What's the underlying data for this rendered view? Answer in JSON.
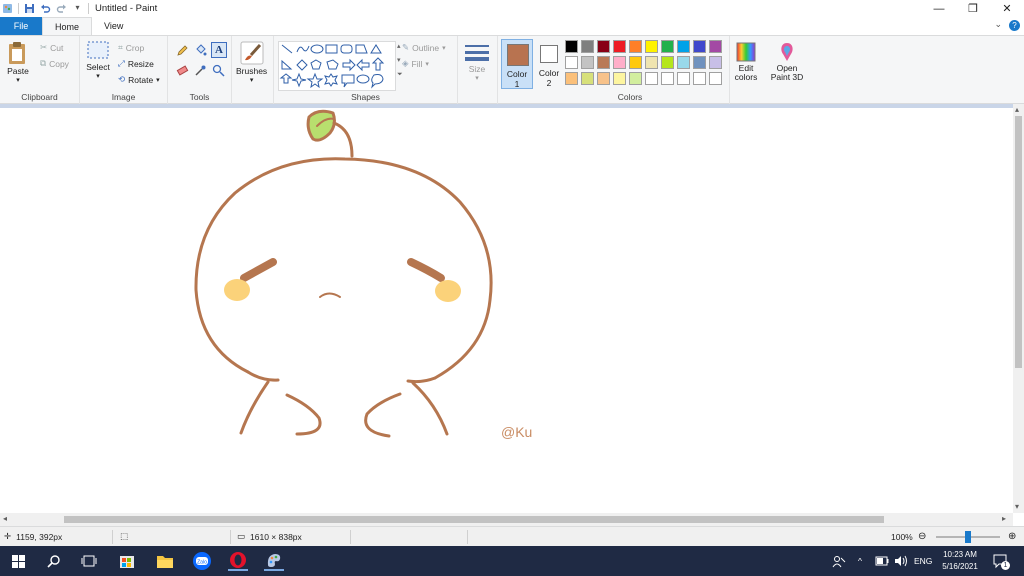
{
  "window": {
    "title": "Untitled - Paint",
    "minimize_glyph": "—",
    "restore_glyph": "❐",
    "close_glyph": "✕"
  },
  "tabs": [
    {
      "label": "File"
    },
    {
      "label": "Home"
    },
    {
      "label": "View"
    }
  ],
  "ribbon": {
    "clipboard": {
      "label": "Clipboard",
      "paste": "Paste",
      "cut": "Cut",
      "copy": "Copy"
    },
    "image": {
      "label": "Image",
      "select": "Select",
      "crop": "Crop",
      "resize": "Resize",
      "rotate": "Rotate"
    },
    "tools": {
      "label": "Tools"
    },
    "brushes": {
      "label": "Brushes"
    },
    "shapes": {
      "label": "Shapes",
      "outline": "Outline",
      "fill": "Fill"
    },
    "size": {
      "label": "Size"
    },
    "color1": {
      "label": "Color",
      "num": "1",
      "color": "#b87350"
    },
    "color2": {
      "label": "Color",
      "num": "2",
      "color": "#ffffff"
    },
    "colors": {
      "label": "Colors"
    },
    "edit_colors": {
      "line1": "Edit",
      "line2": "colors"
    },
    "paint3d": {
      "line1": "Open",
      "line2": "Paint 3D"
    },
    "palette": [
      "#000000",
      "#7f7f7f",
      "#880015",
      "#ed1c24",
      "#ff7f27",
      "#fff200",
      "#22b14c",
      "#00a2e8",
      "#3f48cc",
      "#a349a4",
      "#ffffff",
      "#c3c3c3",
      "#b97a57",
      "#ffaec9",
      "#ffc90e",
      "#efe4b0",
      "#b5e61d",
      "#99d9ea",
      "#7092be",
      "#c8bfe7",
      "#fbc07a",
      "#d7e07a",
      "#f7c28a",
      "#fdf5a0",
      "#d2ee9e",
      "#ffffff",
      "#ffffff",
      "#ffffff",
      "#ffffff",
      "#ffffff"
    ]
  },
  "drawing": {
    "stroke_color": "#b5764f",
    "cheek_color": "#fbd27a",
    "leaf_color": "#b8df6e",
    "signature": "@Ku",
    "signature_color": "#c98c63"
  },
  "status": {
    "cursor_pos": "1159, 392px",
    "image_size": "1610 × 838px",
    "zoom": "100%"
  },
  "taskbar": {
    "lang": "ENG",
    "time": "10:23 AM",
    "date": "5/16/2021",
    "notification_count": "1"
  }
}
